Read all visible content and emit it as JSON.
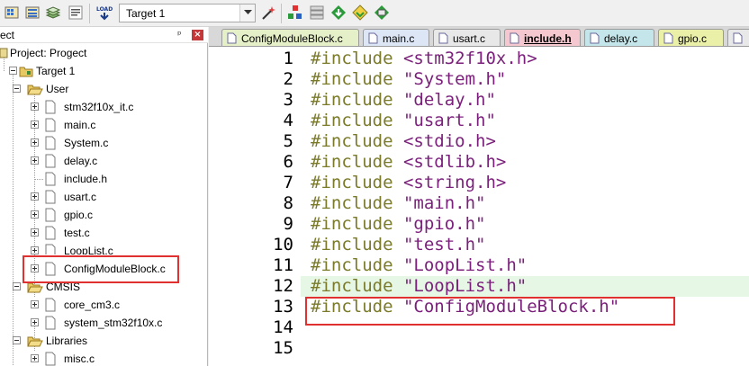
{
  "toolbar": {
    "target_select": {
      "value": "Target 1"
    },
    "buttons": [
      "build-target-icon",
      "rebuild-icon",
      "batch-build-icon",
      "load-flash-icon",
      "options-wand-icon",
      "manage-components-icon",
      "manage-packs-icon",
      "select-device-icon",
      "pack-installer-icon",
      "rte-icon"
    ],
    "load_label": "LOAD"
  },
  "project_panel": {
    "title": "ect",
    "pin": "ᵖ",
    "close": "×",
    "root": "Project: Progect",
    "target": "Target 1",
    "groups": [
      {
        "name": "User",
        "files": [
          "stm32f10x_it.c",
          "main.c",
          "System.c",
          "delay.c",
          "include.h",
          "usart.c",
          "gpio.c",
          "test.c",
          "LoopList.c",
          "ConfigModuleBlock.c"
        ]
      },
      {
        "name": "CMSIS",
        "files": [
          "core_cm3.c",
          "system_stm32f10x.c"
        ]
      },
      {
        "name": "Libraries",
        "files": [
          "misc.c"
        ]
      }
    ]
  },
  "editor": {
    "tabs": [
      {
        "label": "ConfigModuleBlock.c",
        "color": "#e6f0c8",
        "active": false
      },
      {
        "label": "main.c",
        "color": "#dde6f5",
        "active": false
      },
      {
        "label": "usart.c",
        "color": "#e8e8e8",
        "active": false
      },
      {
        "label": "include.h",
        "color": "#f5c8cf",
        "active": true
      },
      {
        "label": "delay.c",
        "color": "#c4e6ea",
        "active": false
      },
      {
        "label": "gpio.c",
        "color": "#eaf0a8",
        "active": false
      },
      {
        "label": "",
        "color": "#e8e8e8",
        "active": false
      }
    ],
    "lines": [
      {
        "n": "1",
        "kw": "#include",
        "arg": "<stm32f10x.h>"
      },
      {
        "n": "2",
        "kw": "#include",
        "arg": "\"System.h\""
      },
      {
        "n": "3",
        "kw": "#include",
        "arg": "\"delay.h\""
      },
      {
        "n": "4",
        "kw": "#include",
        "arg": "\"usart.h\""
      },
      {
        "n": "5",
        "kw": "#include",
        "arg": "<stdio.h>"
      },
      {
        "n": "6",
        "kw": "#include",
        "arg": "<stdlib.h>"
      },
      {
        "n": "7",
        "kw": "#include",
        "arg": "<string.h>"
      },
      {
        "n": "8",
        "kw": "#include",
        "arg": "\"main.h\""
      },
      {
        "n": "9",
        "kw": "#include",
        "arg": "\"gpio.h\""
      },
      {
        "n": "10",
        "kw": "#include",
        "arg": "\"test.h\""
      },
      {
        "n": "11",
        "kw": "#include",
        "arg": "\"LoopList.h\""
      },
      {
        "n": "12",
        "kw": "#include",
        "arg": "\"LoopList.h\""
      },
      {
        "n": "13",
        "kw": "#include",
        "arg": "\"ConfigModuleBlock.h\""
      },
      {
        "n": "14",
        "kw": "",
        "arg": ""
      },
      {
        "n": "15",
        "kw": "",
        "arg": ""
      }
    ],
    "current_line": "12"
  },
  "colors": {
    "keyword": "#7a7a2a",
    "string": "#7a1f7a",
    "highlight_box": "#e03030",
    "current_line_bg": "#e6f7e6"
  }
}
